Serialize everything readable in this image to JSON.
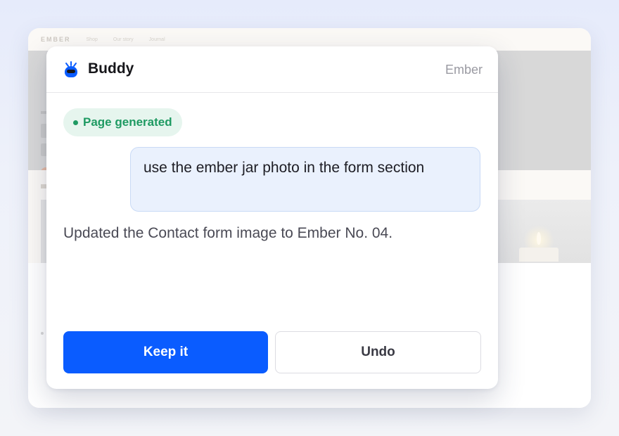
{
  "site_preview": {
    "logo": "EMBER",
    "nav_links": [
      "Shop",
      "Our story",
      "Journal"
    ]
  },
  "panel": {
    "title": "Buddy",
    "title_icon": "buddy-bot-icon",
    "site_name": "Ember",
    "status": {
      "label": "Page generated",
      "color": "#1e9a62"
    },
    "messages": {
      "user": "use the ember jar photo in the form section",
      "assistant": "Updated the Contact form image to Ember No. 04."
    },
    "actions": {
      "keep_label": "Keep it",
      "undo_label": "Undo"
    }
  },
  "colors": {
    "accent": "#0a5cff",
    "user_bubble": "#eaf1fd",
    "status_bg": "#e6f5ee"
  }
}
